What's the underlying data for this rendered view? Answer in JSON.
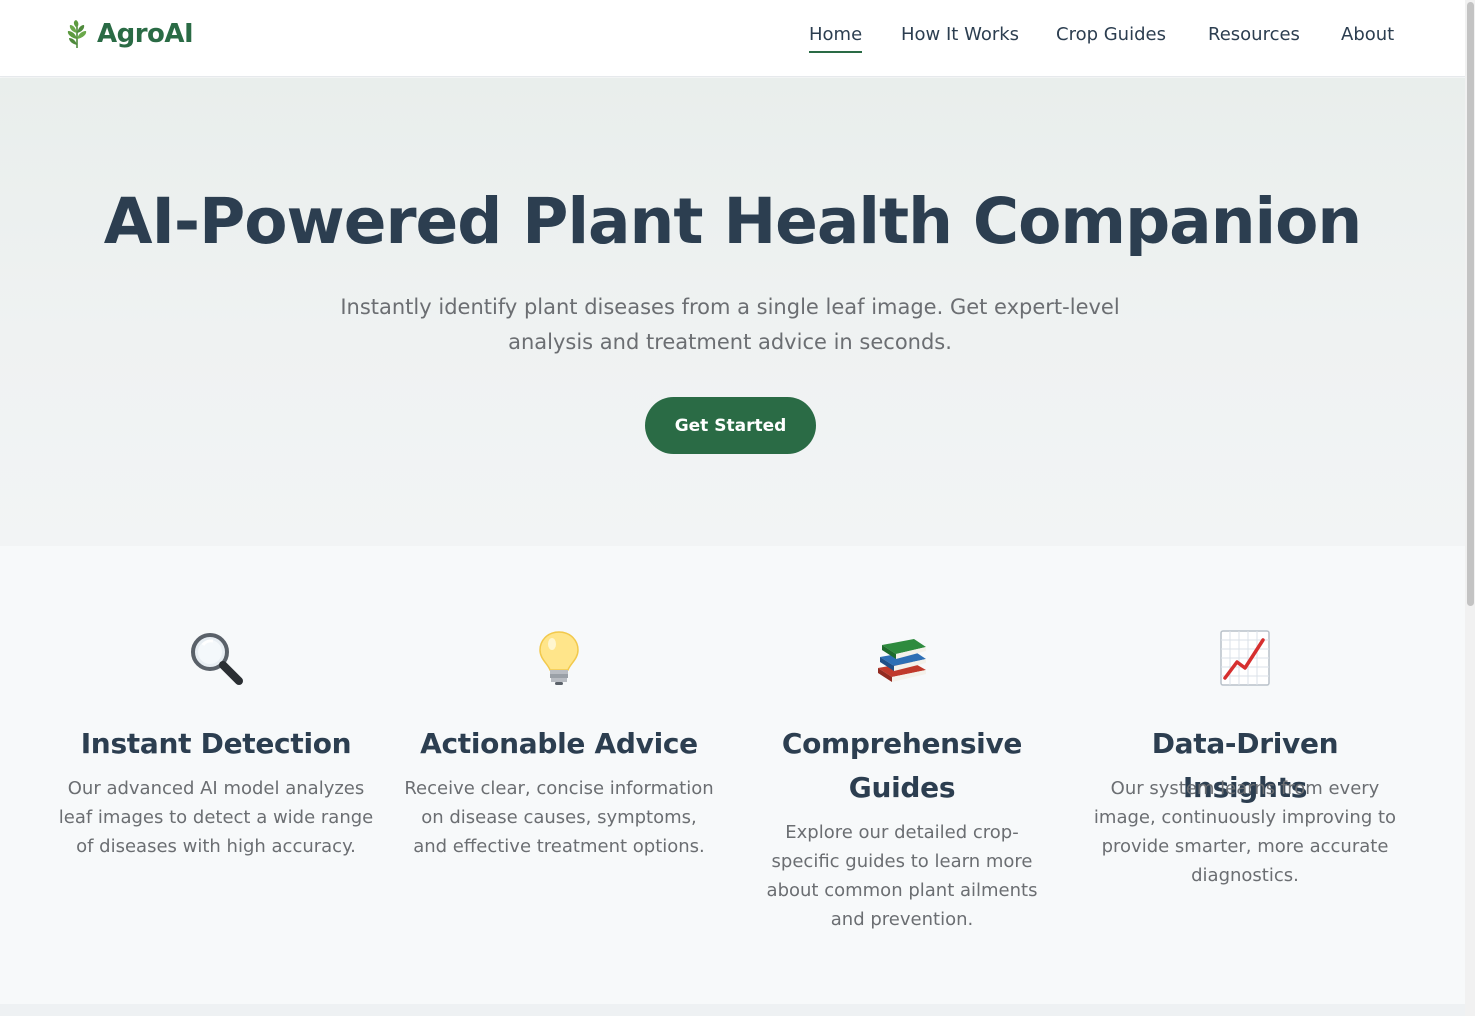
{
  "brand": {
    "name": "AgroAI",
    "icon": "leaf-icon",
    "color": "#2a6b45"
  },
  "nav": {
    "items": [
      {
        "label": "Home",
        "active": true
      },
      {
        "label": "How It Works",
        "active": false
      },
      {
        "label": "Crop Guides",
        "active": false
      },
      {
        "label": "Resources",
        "active": false
      },
      {
        "label": "About",
        "active": false
      }
    ]
  },
  "hero": {
    "title": "AI-Powered Plant Health Companion",
    "subtitle": "Instantly identify plant diseases from a single leaf image. Get expert-level analysis and treatment advice in seconds.",
    "cta_label": "Get Started"
  },
  "features": [
    {
      "icon": "magnifying-glass-icon",
      "title": "Instant Detection",
      "description": "Our advanced AI model analyzes leaf images to detect a wide range of diseases with high accuracy."
    },
    {
      "icon": "light-bulb-icon",
      "title": "Actionable Advice",
      "description": "Receive clear, concise information on disease causes, symptoms, and effective treatment options."
    },
    {
      "icon": "books-icon",
      "title": "Comprehensive Guides",
      "description": "Explore our detailed crop-specific guides to learn more about common plant ailments and prevention."
    },
    {
      "icon": "chart-increasing-icon",
      "title": "Data-Driven Insights",
      "description": "Our system learns from every image, continuously improving to provide smarter, more accurate diagnostics."
    }
  ],
  "colors": {
    "primary": "#2a6b45",
    "heading": "#2c3e50",
    "body_text": "#6b6e72",
    "hero_bg": "#eef1f0",
    "page_bg": "#f7f9fa"
  }
}
